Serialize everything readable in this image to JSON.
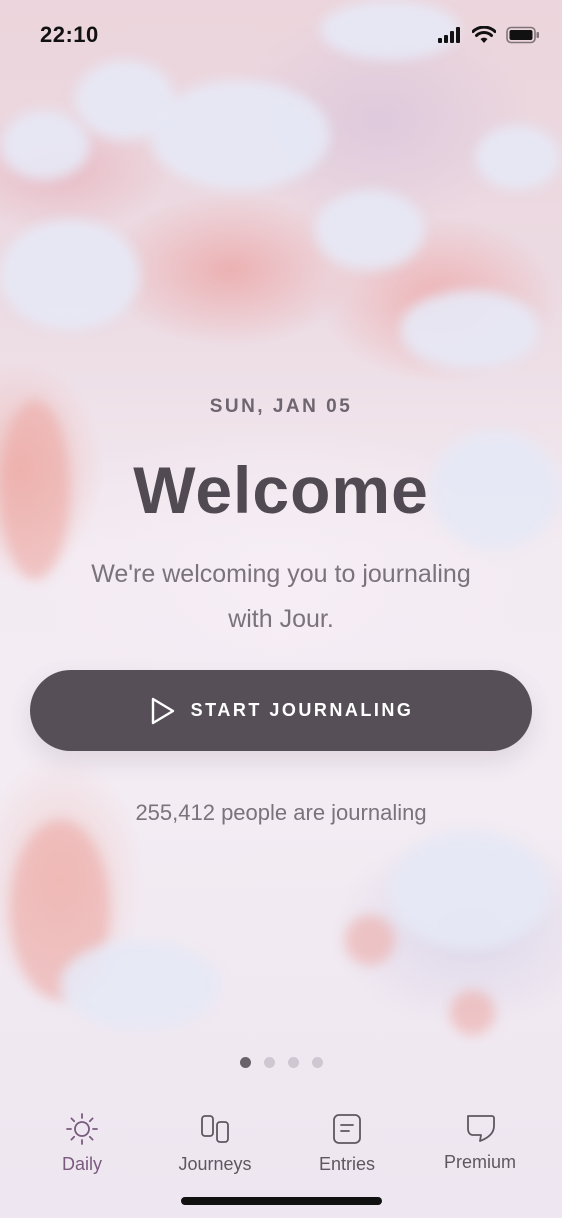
{
  "status_bar": {
    "time": "22:10"
  },
  "hero": {
    "date": "SUN, JAN 05",
    "title": "Welcome",
    "subtitle_line1": "We're welcoming you to journaling",
    "subtitle_line2": "with Jour.",
    "cta_label": "START JOURNALING",
    "counter_text": "255,412 people are journaling"
  },
  "pager": {
    "count": 4,
    "active_index": 0
  },
  "tabs": [
    {
      "label": "Daily",
      "icon": "sun-icon",
      "active": true
    },
    {
      "label": "Journeys",
      "icon": "journeys-icon",
      "active": false
    },
    {
      "label": "Entries",
      "icon": "entries-icon",
      "active": false
    },
    {
      "label": "Premium",
      "icon": "premium-icon",
      "active": false
    }
  ],
  "colors": {
    "button": "#574f58",
    "active_tab": "#7a5a7e",
    "title": "#514a52"
  }
}
